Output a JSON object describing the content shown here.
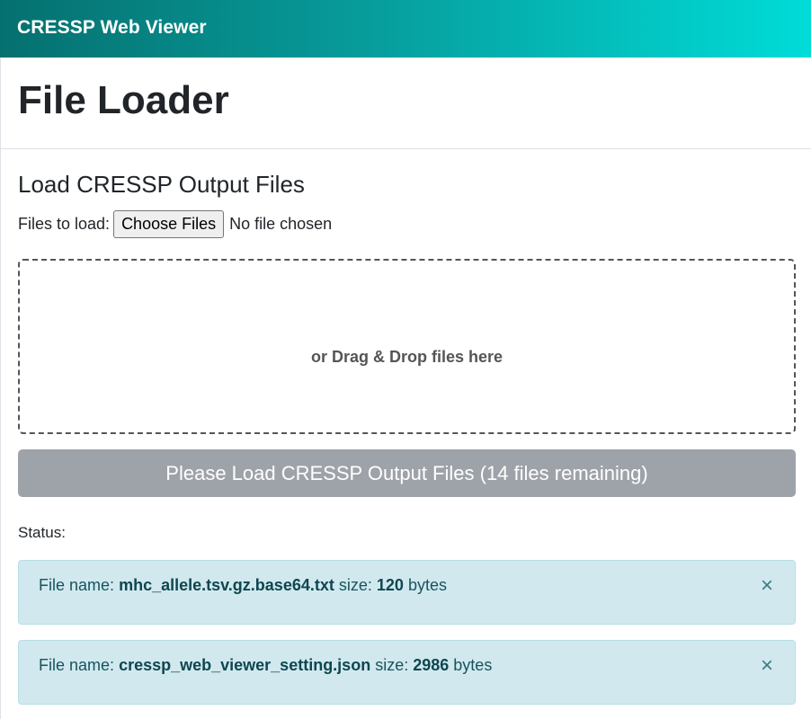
{
  "navbar": {
    "brand": "CRESSP Web Viewer"
  },
  "header": {
    "title": "File Loader"
  },
  "loader": {
    "section_title": "Load CRESSP Output Files",
    "files_label": "Files to load:",
    "choose_button": "Choose Files",
    "no_file_text": "No file chosen",
    "dropzone_text": "or Drag & Drop files here",
    "load_button": "Please Load CRESSP Output Files (14 files remaining)"
  },
  "status": {
    "label": "Status:",
    "alerts": [
      {
        "prefix": "File name:",
        "file_name": "mhc_allele.tsv.gz.base64.txt",
        "size_label": "size:",
        "size": "120",
        "unit": "bytes",
        "close": "×"
      },
      {
        "prefix": "File name:",
        "file_name": "cressp_web_viewer_setting.json",
        "size_label": "size:",
        "size": "2986",
        "unit": "bytes",
        "close": "×"
      }
    ]
  },
  "colors": {
    "navbar_start": "#05706f",
    "navbar_end": "#00dcd8",
    "button_disabled": "#9ea3a9",
    "alert_bg": "#d1e9ee"
  }
}
